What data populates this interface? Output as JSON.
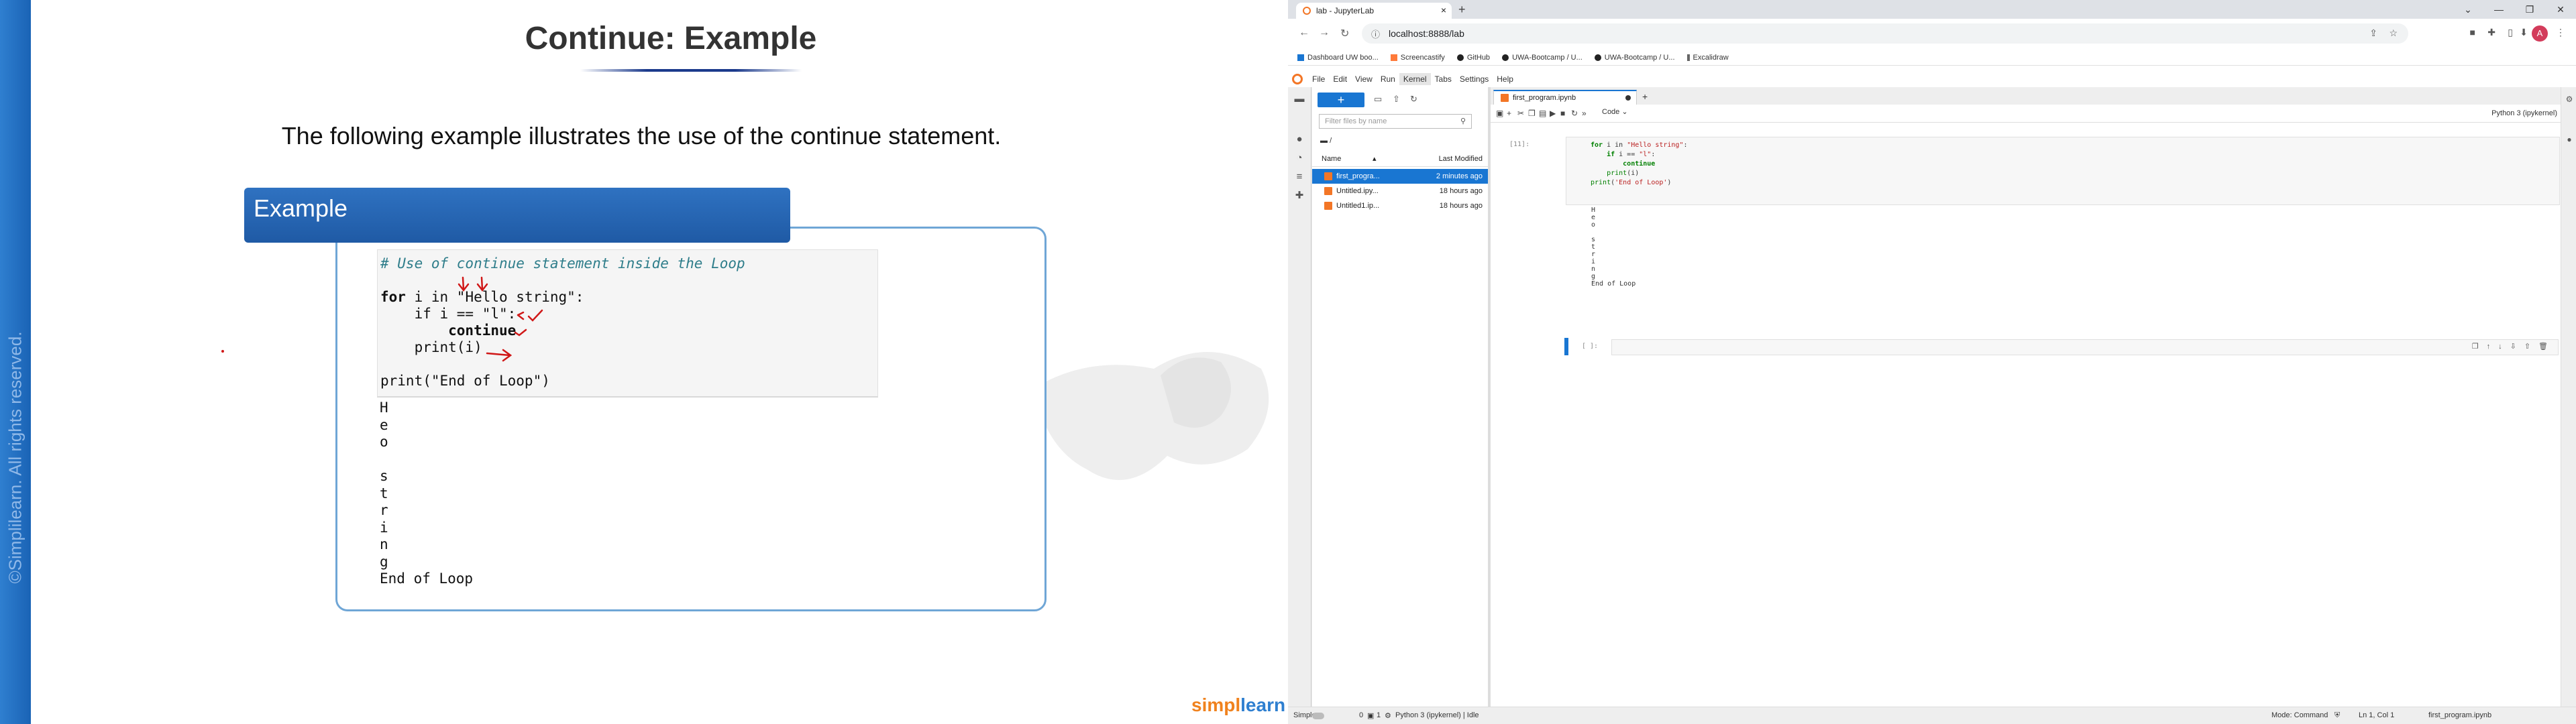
{
  "slide": {
    "title": "Continue: Example",
    "intro": "The following example illustrates the use of the continue statement.",
    "box_label": "Example",
    "copyright": "©Simplilearn. All rights reserved.",
    "code": {
      "comment": "# Use of continue statement inside the Loop",
      "line1_kw_for": "for",
      "line1_rest": " i in \"Hello string\":",
      "line2": "    if i == \"l\":",
      "line3": "        continue",
      "line4": "    print(i)",
      "line5": "print(\"End of Loop\")"
    },
    "output": [
      "H",
      "e",
      "o",
      "",
      "s",
      "t",
      "r",
      "i",
      "n",
      "g",
      "End of Loop"
    ],
    "logo_part1": "simpl",
    "logo_part2": "learn",
    "colors": {
      "accent_blue": "#1f5aa5",
      "annotation_red": "#d01818"
    }
  },
  "browser": {
    "tab_title": "lab - JupyterLab",
    "url": "localhost:8888/lab",
    "bookmarks": [
      "Dashboard UW boo...",
      "Screencastify",
      "GitHub",
      "UWA-Bootcamp / U...",
      "UWA-Bootcamp / U...",
      "Excalidraw"
    ],
    "avatar_letter": "A"
  },
  "jupyter": {
    "menus": [
      "File",
      "Edit",
      "View",
      "Run",
      "Kernel",
      "Tabs",
      "Settings",
      "Help"
    ],
    "filter_placeholder": "Filter files by name",
    "breadcrumb": "/",
    "col_name": "Name",
    "col_modified": "Last Modified",
    "files": [
      {
        "name": "first_progra...",
        "modified": "2 minutes ago",
        "selected": true
      },
      {
        "name": "Untitled.ipy...",
        "modified": "18 hours ago",
        "selected": false
      },
      {
        "name": "Untitled1.ip...",
        "modified": "18 hours ago",
        "selected": false
      }
    ],
    "doc_tab": "first_program.ipynb",
    "cell_type": "Code",
    "kernel": "Python 3 (ipykernel)",
    "cell1_prompt": "[11]:",
    "cell1_code": {
      "l1a": "for",
      "l1b": " i in ",
      "l1c": "\"Hello string\"",
      "l1d": ":",
      "l2a": "    if",
      "l2b": " i == ",
      "l2c": "\"l\"",
      "l2d": ":",
      "l3": "        continue",
      "l4a": "    print",
      "l4b": "(i)",
      "l5a": "print",
      "l5b": "(",
      "l5c": "'End of Loop'",
      "l5d": ")"
    },
    "cell1_output": [
      "H",
      "e",
      "o",
      "",
      "s",
      "t",
      "r",
      "i",
      "n",
      "g",
      "End of Loop"
    ],
    "cell2_prompt": "[ ]:",
    "status": {
      "simple": "Simple",
      "num1": "0",
      "num2": "1",
      "kernel_state": "Python 3 (ipykernel) | Idle",
      "mode": "Mode: Command",
      "position": "Ln 1, Col 1",
      "file": "first_program.ipynb"
    }
  }
}
